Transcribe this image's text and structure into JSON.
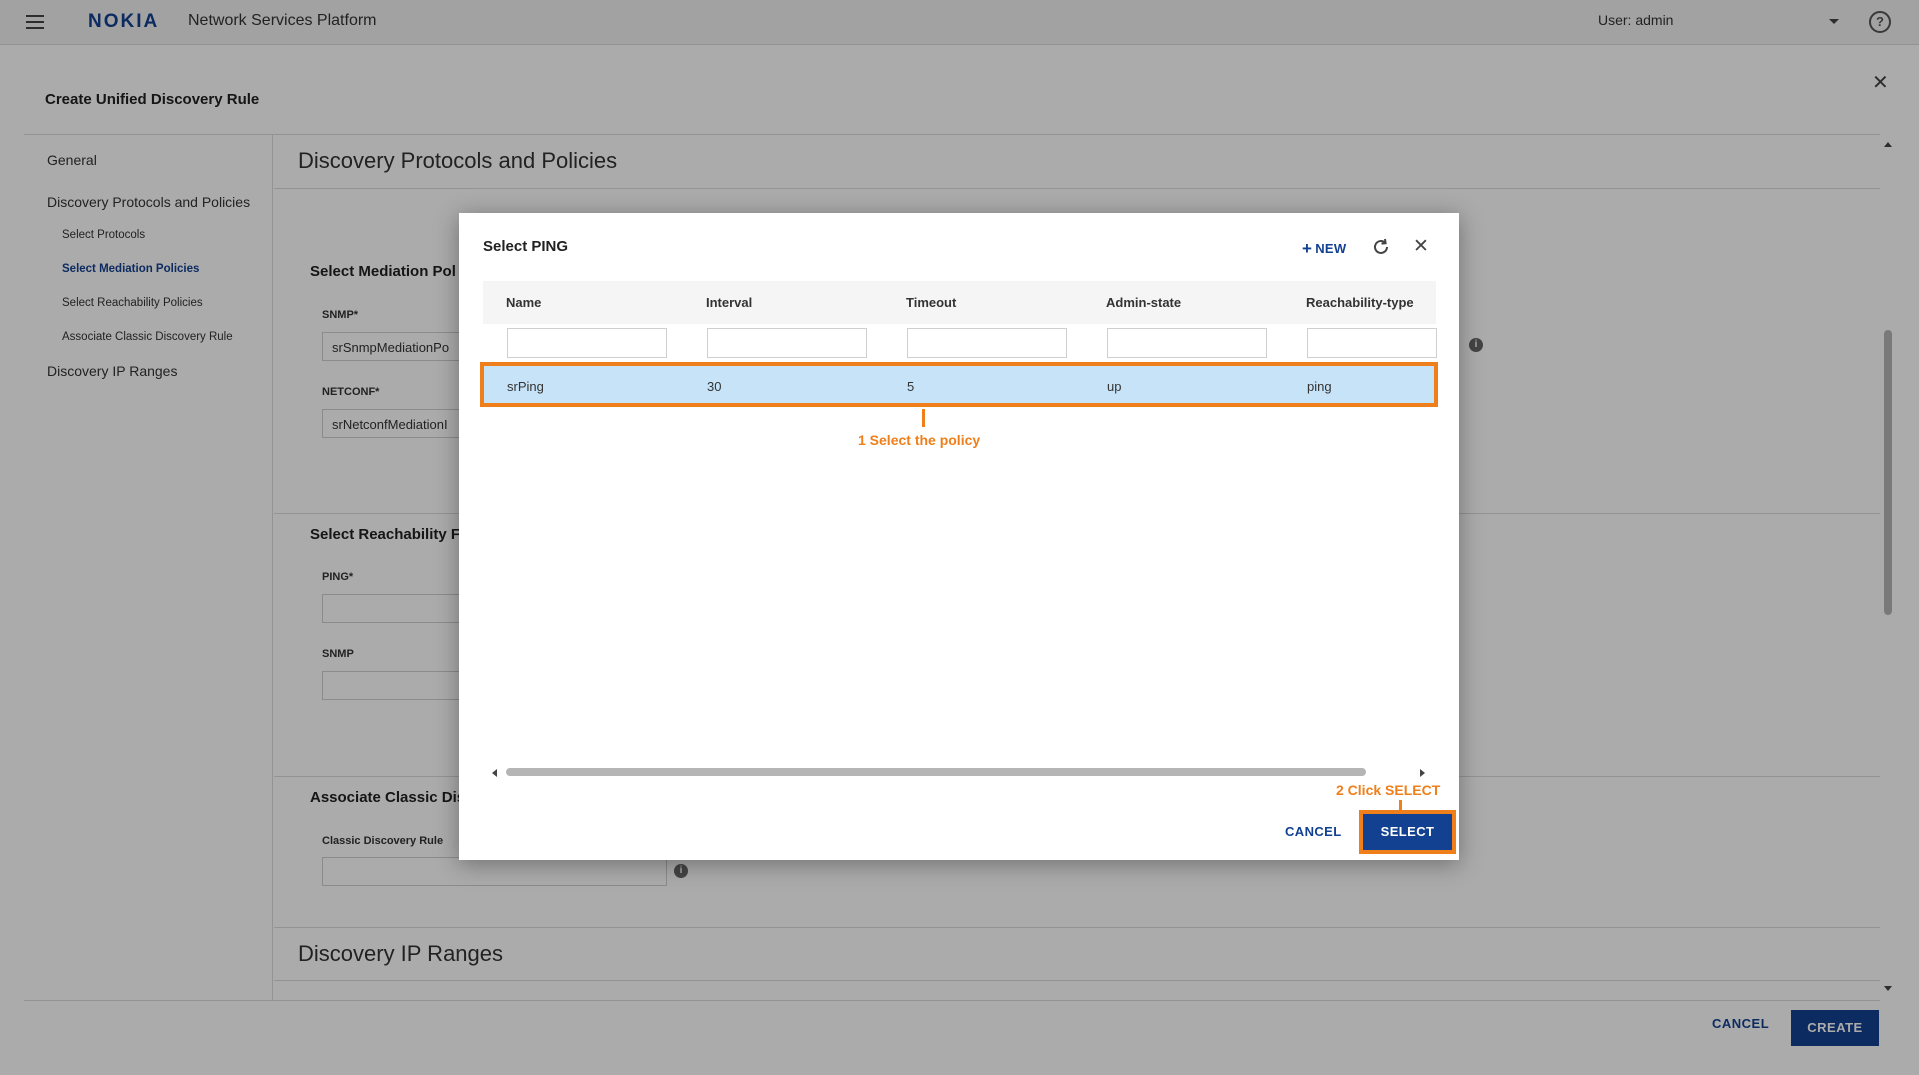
{
  "app": {
    "brand": "NOKIA",
    "title": "Network Services Platform",
    "user": "User: admin",
    "help_glyph": "?"
  },
  "page": {
    "title": "Create Unified Discovery Rule",
    "close_glyph": "✕",
    "nav": [
      {
        "label": "General"
      },
      {
        "label": "Discovery Protocols and Policies"
      },
      {
        "label": "Select Protocols"
      },
      {
        "label": "Select Mediation Policies"
      },
      {
        "label": "Select Reachability Policies"
      },
      {
        "label": "Associate Classic Discovery Rule"
      },
      {
        "label": "Discovery IP Ranges"
      }
    ],
    "sections": {
      "protocols_title": "Discovery Protocols and Policies",
      "mediation_title": "Select Mediation Pol",
      "snmp_label": "SNMP*",
      "snmp_value": "srSnmpMediationPo",
      "netconf_label": "NETCONF*",
      "netconf_value": "srNetconfMediationI",
      "reachability_title": "Select Reachability F",
      "ping_label": "PING*",
      "ping_value": "",
      "snmp2_label": "SNMP",
      "snmp2_value": "",
      "classic_title": "Associate Classic Dis",
      "classic_label": "Classic Discovery Rule",
      "classic_value": "",
      "ip_ranges_title": "Discovery IP Ranges"
    },
    "info_glyph": "i",
    "footer": {
      "cancel_label": "CANCEL",
      "create_label": "CREATE"
    }
  },
  "dialog": {
    "title": "Select PING",
    "new_label": "NEW",
    "new_glyph": "+",
    "close_glyph": "✕",
    "columns": [
      "Name",
      "Interval",
      "Timeout",
      "Admin-state",
      "Reachability-type"
    ],
    "rows": [
      {
        "name": "srPing",
        "interval": "30",
        "timeout": "5",
        "admin_state": "up",
        "reachability_type": "ping"
      }
    ],
    "cancel_label": "CANCEL",
    "select_label": "SELECT"
  },
  "annotations": {
    "step1": "1  Select the policy",
    "step2": "2  Click SELECT",
    "color": "#ef7f1a"
  },
  "colors": {
    "brand": "#124191",
    "row_selected": "#c6e3f8",
    "highlight": "#ef7f1a"
  },
  "icons": [
    "menu-icon",
    "help-icon",
    "close-icon",
    "info-icon",
    "refresh-icon",
    "plus-icon",
    "caret-down-icon"
  ]
}
